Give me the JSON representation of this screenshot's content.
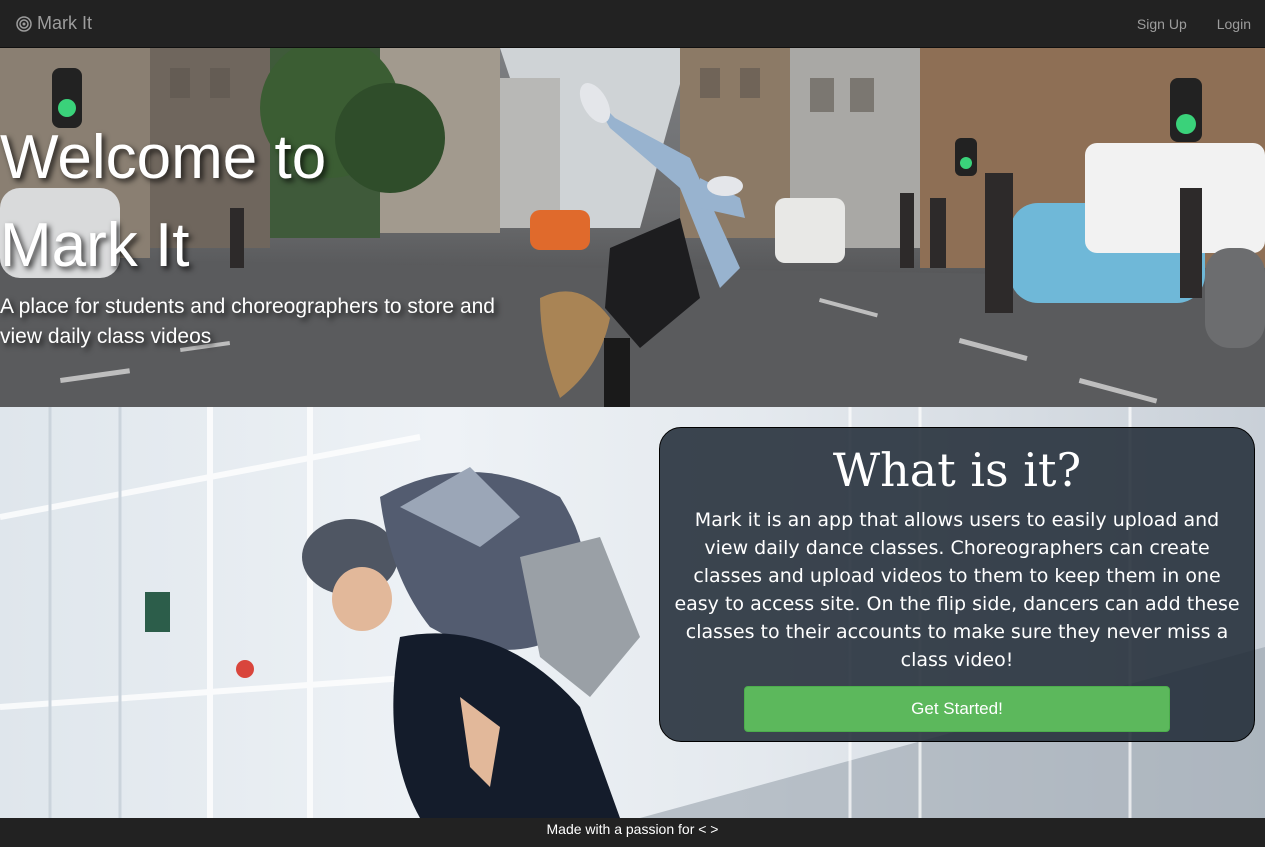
{
  "navbar": {
    "brand": "Mark It",
    "brand_icon": "target-icon",
    "links": {
      "signup": "Sign Up",
      "login": "Login"
    }
  },
  "hero": {
    "title_line1": "Welcome to",
    "title_line2": "Mark It",
    "subtitle": "A place for students and choreographers to store and view daily class videos"
  },
  "about": {
    "heading": "What is it?",
    "body": "Mark it is an app that allows users to easily upload and view daily dance classes. Choreographers can create classes and upload videos to them to keep them in one easy to access site. On the flip side, dancers can add these classes to their accounts to make sure they never miss a class video!",
    "button": "Get Started!"
  },
  "footer": {
    "text": "Made with a passion for < >"
  },
  "colors": {
    "navbar": "#222222",
    "nav_text": "#9d9d9d",
    "cta": "#5cb85c",
    "card": "#222c38"
  }
}
